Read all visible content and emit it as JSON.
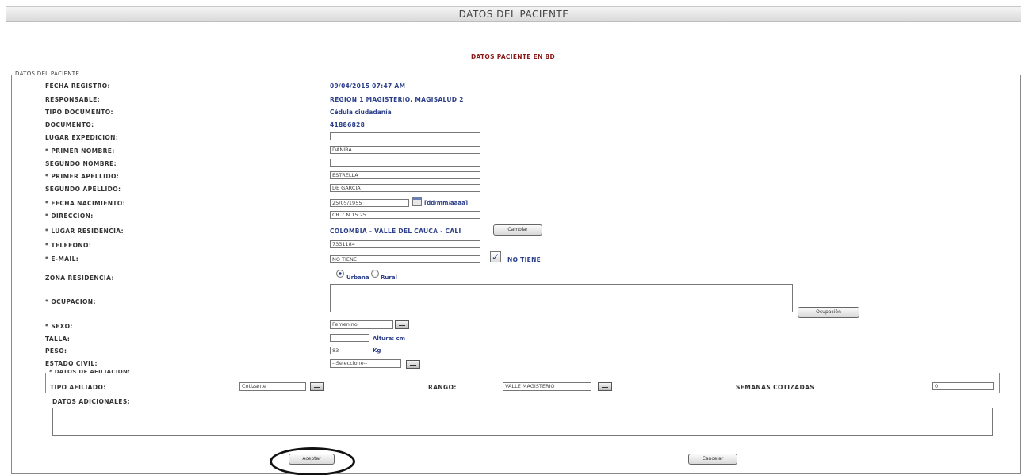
{
  "window": {
    "title": "DATOS DEL PACIENTE"
  },
  "status": {
    "message": "DATOS PACIENTE EN BD"
  },
  "patient": {
    "legend": "DATOS DEL PACIENTE",
    "fecha_registro": {
      "label": "FECHA REGISTRO:",
      "value": "09/04/2015 07:47 AM"
    },
    "responsable": {
      "label": "RESPONSABLE:",
      "value": "REGION 1 MAGISTERIO, MAGISALUD 2"
    },
    "tipo_documento": {
      "label": "TIPO DOCUMENTO:",
      "value": "Cédula ciudadanía"
    },
    "documento": {
      "label": "DOCUMENTO:",
      "value": "41886828"
    },
    "lugar_expedicion": {
      "label": "LUGAR EXPEDICION:",
      "value": ""
    },
    "primer_nombre": {
      "label": "* PRIMER NOMBRE:",
      "value": "DANIRA"
    },
    "segundo_nombre": {
      "label": "SEGUNDO NOMBRE:",
      "value": ""
    },
    "primer_apellido": {
      "label": "* PRIMER APELLIDO:",
      "value": "ESTRELLA"
    },
    "segundo_apellido": {
      "label": "SEGUNDO APELLIDO:",
      "value": "DE GARCIA"
    },
    "fecha_nacimiento": {
      "label": "* FECHA NACIMIENTO:",
      "value": "25/05/1955",
      "format": "[dd/mm/aaaa]"
    },
    "direccion": {
      "label": "* DIRECCION:",
      "value": "CR 7 N 15 25"
    },
    "lugar_residencia": {
      "label": "* LUGAR RESIDENCIA:",
      "value": "COLOMBIA - VALLE DEL CAUCA - CALI",
      "button": "Cambiar"
    },
    "telefono": {
      "label": "* TELEFONO:",
      "value": "7331184"
    },
    "email": {
      "label": "* E-MAIL:",
      "value": "NO TIENE",
      "checkbox_label": "NO TIENE",
      "checked": true
    },
    "zona_residencia": {
      "label": "ZONA RESIDENCIA:",
      "options": [
        "Urbana",
        "Rural"
      ],
      "selected": "Urbana"
    },
    "ocupacion": {
      "label": "* OCUPACION:",
      "value": "",
      "button": "Ocupación"
    },
    "sexo": {
      "label": "* SEXO:",
      "value": "Femenino"
    },
    "talla": {
      "label": "TALLA:",
      "value": "",
      "unit": "Altura: cm"
    },
    "peso": {
      "label": "PESO:",
      "value": "83",
      "unit": "Kg"
    },
    "estado_civil": {
      "label": "ESTADO CIVIL:",
      "value": "--Seleccione--"
    }
  },
  "afiliacion": {
    "legend": "* DATOS DE AFILIACION:",
    "tipo_afiliado": {
      "label": "TIPO AFILIADO:",
      "value": "Cotizante"
    },
    "rango": {
      "label": "RANGO:",
      "value": "VALLE MAGISTERIO"
    },
    "semanas": {
      "label": "SEMANAS COTIZADAS",
      "value": "0"
    }
  },
  "adicionales": {
    "label": "DATOS ADICIONALES:",
    "value": ""
  },
  "actions": {
    "accept": "Aceptar",
    "cancel": "Cancelar"
  },
  "icons": {
    "calendar": "calendar-icon",
    "checkmark": "✓"
  }
}
